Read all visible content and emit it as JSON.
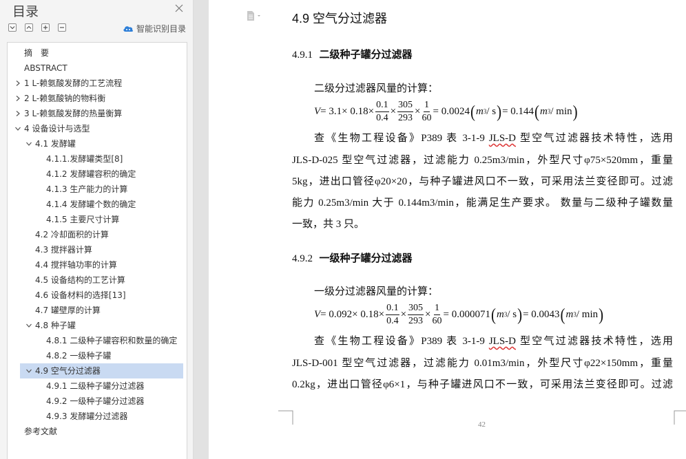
{
  "toc": {
    "title": "目录",
    "smart_label": "智能识别目录",
    "items": [
      {
        "label": "摘　要"
      },
      {
        "label": "ABSTRACT"
      },
      {
        "label": "1 L-赖氨酸发酵的工艺流程"
      },
      {
        "label": "2 L-赖氨酸钠的物料衡"
      },
      {
        "label": "3 L-赖氨酸发酵的热量衡算"
      },
      {
        "label": "4 设备设计与选型"
      },
      {
        "label": "4.1 发酵罐"
      },
      {
        "label": "4.1.1.发酵罐类型[8]"
      },
      {
        "label": "4.1.2 发酵罐容积的确定"
      },
      {
        "label": "4.1.3 生产能力的计算"
      },
      {
        "label": "4.1.4 发酵罐个数的确定"
      },
      {
        "label": "4.1.5 主要尺寸计算"
      },
      {
        "label": "4.2 冷却面积的计算"
      },
      {
        "label": "4.3 搅拌器计算"
      },
      {
        "label": "4.4 搅拌轴功率的计算"
      },
      {
        "label": "4.5 设备结构的工艺计算"
      },
      {
        "label": "4.6 设备材料的选择[13]"
      },
      {
        "label": "4.7 罐壁厚的计算"
      },
      {
        "label": "4.8 种子罐"
      },
      {
        "label": "4.8.1 二级种子罐容积和数量的确定"
      },
      {
        "label": "4.8.2 一级种子罐"
      },
      {
        "label": "4.9 空气分过滤器"
      },
      {
        "label": "4.9.1 二级种子罐分过滤器"
      },
      {
        "label": "4.9.2 一级种子罐分过滤器"
      },
      {
        "label": "4.9.3 发酵罐分过滤器"
      },
      {
        "label": "参考文献"
      }
    ]
  },
  "doc": {
    "section_title": "4.9  空气分过滤器",
    "sub1_num": "4.9.1",
    "sub1_title": "二级种子罐分过滤器",
    "sub1_intro": "二级分过滤器风量的计算：",
    "f1": {
      "lhs": "V",
      "eq": " = 3.1× 0.18×",
      "a_n": "0.1",
      "a_d": "0.4",
      "b_n": "305",
      "b_d": "293",
      "c_n": "1",
      "c_d": "60",
      "r1": " = 0.0024",
      "u1": "m",
      "u1b": " / s",
      "r2": " = 0.144",
      "u2": "m",
      "u2b": " / min"
    },
    "p1_l1a": "查《生物工程设备》P389  表 3-1-9 ",
    "p1_l1b": "JLS-D",
    "p1_l1c": " 型空气过滤器技术特性，选用",
    "p1_l2": "JLS-D-025 型空气过滤器，过滤能力 0.25m3/min，外型尺寸φ75×520mm，重量",
    "p1_l3": "5kg，进出口管径φ20×20，与种子罐进风口不一致，可采用法兰变径即可。过滤",
    "p1_l4": "能力 0.25m3/min 大于 0.144m3/min，能满足生产要求。  数量与二级种子罐数量",
    "p1_l5": "一致，共 3 只。",
    "sub2_num": "4.9.2",
    "sub2_title": "一级种子罐分过滤器",
    "sub2_intro": "一级分过滤器风量的计算：",
    "f2": {
      "lhs": "V",
      "eq": " = 0.092× 0.18×",
      "a_n": "0.1",
      "a_d": "0.4",
      "b_n": "305",
      "b_d": "293",
      "c_n": "1",
      "c_d": "60",
      "r1": " = 0.000071",
      "u1": "m",
      "u1b": " / s",
      "r2": " = 0.0043",
      "u2": "m",
      "u2b": " / min"
    },
    "p2_l1a": "查《生物工程设备》P389  表 3-1-9 ",
    "p2_l1b": "JLS-D",
    "p2_l1c": " 型空气过滤器技术特性，选用",
    "p2_l2": "JLS-D-001 型空气过滤器，过滤能力 0.01m3/min，外型尺寸φ22×150mm，重量",
    "p2_l3": "0.2kg，进出口管径φ6×1，与种子罐进风口不一致，可采用法兰变径即可。过滤",
    "page_number": "42"
  },
  "colors": {
    "selected_bg": "#c9daf2",
    "accent": "#2e7fd8"
  }
}
